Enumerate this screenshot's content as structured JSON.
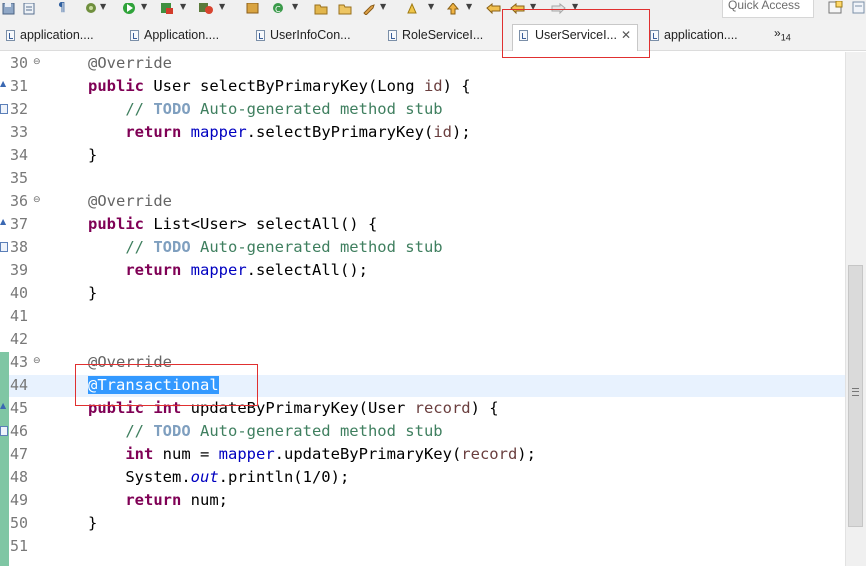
{
  "toolbar": {
    "quick_access": "Quick Access",
    "icons": [
      "save-icon",
      "debug-icon",
      "run-icon",
      "external-tools-icon",
      "new-icon",
      "open-type-icon",
      "search-icon",
      "back-icon",
      "forward-icon",
      "perspective-icon"
    ]
  },
  "tabs": [
    {
      "label": "application...."
    },
    {
      "label": "Application...."
    },
    {
      "label": "UserInfoCon..."
    },
    {
      "label": "RoleServiceI..."
    },
    {
      "label": "UserServiceI...",
      "active": true
    },
    {
      "label": "application...."
    }
  ],
  "tab_overflow": {
    "chevron": "»",
    "count": "14"
  },
  "editor": {
    "current_line": "44",
    "selection": "@Transactional",
    "lines": [
      {
        "n": "30"
      },
      {
        "n": "31"
      },
      {
        "n": "32"
      },
      {
        "n": "33"
      },
      {
        "n": "34"
      },
      {
        "n": "35"
      },
      {
        "n": "36"
      },
      {
        "n": "37"
      },
      {
        "n": "38"
      },
      {
        "n": "39"
      },
      {
        "n": "40"
      },
      {
        "n": "41"
      },
      {
        "n": "42"
      },
      {
        "n": "43"
      },
      {
        "n": "44"
      },
      {
        "n": "45"
      },
      {
        "n": "46"
      },
      {
        "n": "47"
      },
      {
        "n": "48"
      },
      {
        "n": "49"
      },
      {
        "n": "50"
      },
      {
        "n": "51"
      }
    ]
  },
  "colors": {
    "keyword": "#7f0055",
    "annotation": "#646464",
    "comment": "#3f7f5f",
    "todo": "#7f9fbf",
    "field": "#0000c0",
    "parameter": "#6a3e3e",
    "selection": "#3399ff",
    "current_line": "#e8f2fe",
    "highlight_box": "#e03030"
  }
}
